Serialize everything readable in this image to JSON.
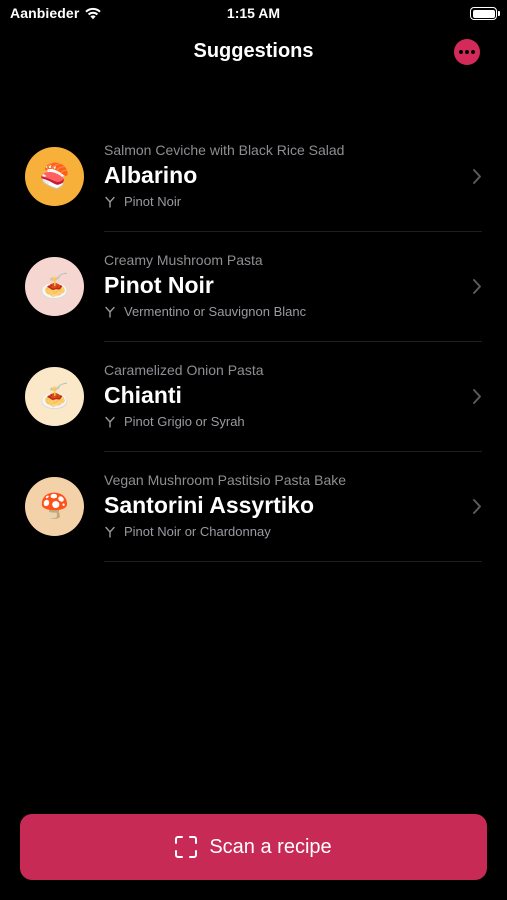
{
  "status_bar": {
    "carrier": "Aanbieder",
    "time": "1:15 AM"
  },
  "nav": {
    "title": "Suggestions",
    "more_icon": "ellipsis-icon"
  },
  "suggestions": [
    {
      "dish": "Salmon Ceviche with Black Rice Salad",
      "wine": "Albarino",
      "alternatives": "Pinot Noir",
      "emoji": "🍣",
      "avatar_color": "#f7b03a"
    },
    {
      "dish": "Creamy Mushroom Pasta",
      "wine": "Pinot Noir",
      "alternatives": "Vermentino or Sauvignon Blanc",
      "emoji": "🍝",
      "avatar_color": "#f6d6d0"
    },
    {
      "dish": "Caramelized Onion Pasta",
      "wine": "Chianti",
      "alternatives": "Pinot Grigio or Syrah",
      "emoji": "🍝",
      "avatar_color": "#fbe8c8"
    },
    {
      "dish": "Vegan Mushroom Pastitsio Pasta Bake",
      "wine": "Santorini Assyrtiko",
      "alternatives": "Pinot Noir or Chardonnay",
      "emoji": "🍄",
      "avatar_color": "#f4d2a9"
    }
  ],
  "scan_button": {
    "label": "Scan a recipe",
    "icon": "scan-viewfinder-icon",
    "color": "#c72a55"
  },
  "colors": {
    "accent": "#d42a5a",
    "background": "#000000",
    "secondary_text": "#8e8e93"
  }
}
